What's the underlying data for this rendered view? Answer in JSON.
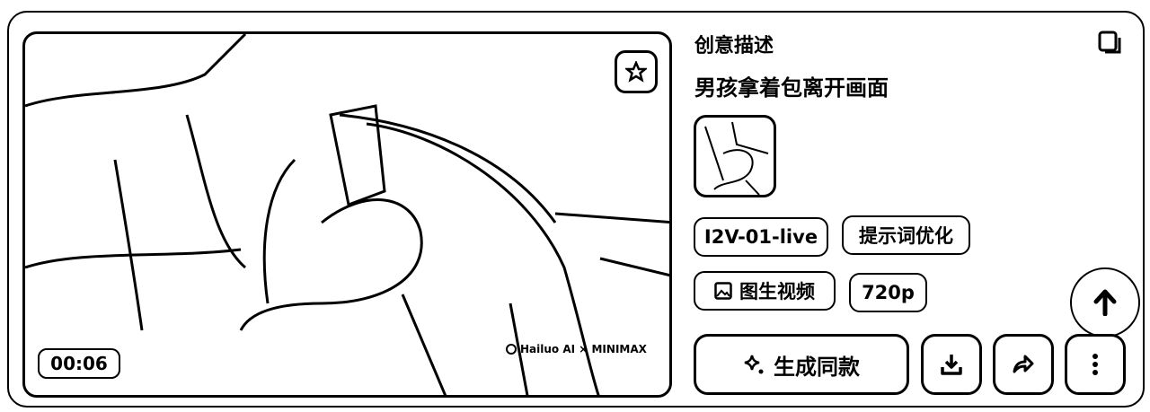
{
  "video": {
    "duration": "00:06",
    "watermark": "Hailuo AI × MINIMAX"
  },
  "details": {
    "section_title": "创意描述",
    "prompt": "男孩拿着包离开画面",
    "tags": [
      {
        "label": "I2V-01-live"
      },
      {
        "label": "提示词优化"
      },
      {
        "label": "图生视频",
        "icon": "image-icon"
      },
      {
        "label": "720p"
      }
    ]
  },
  "actions": {
    "generate_same": "生成同款"
  }
}
